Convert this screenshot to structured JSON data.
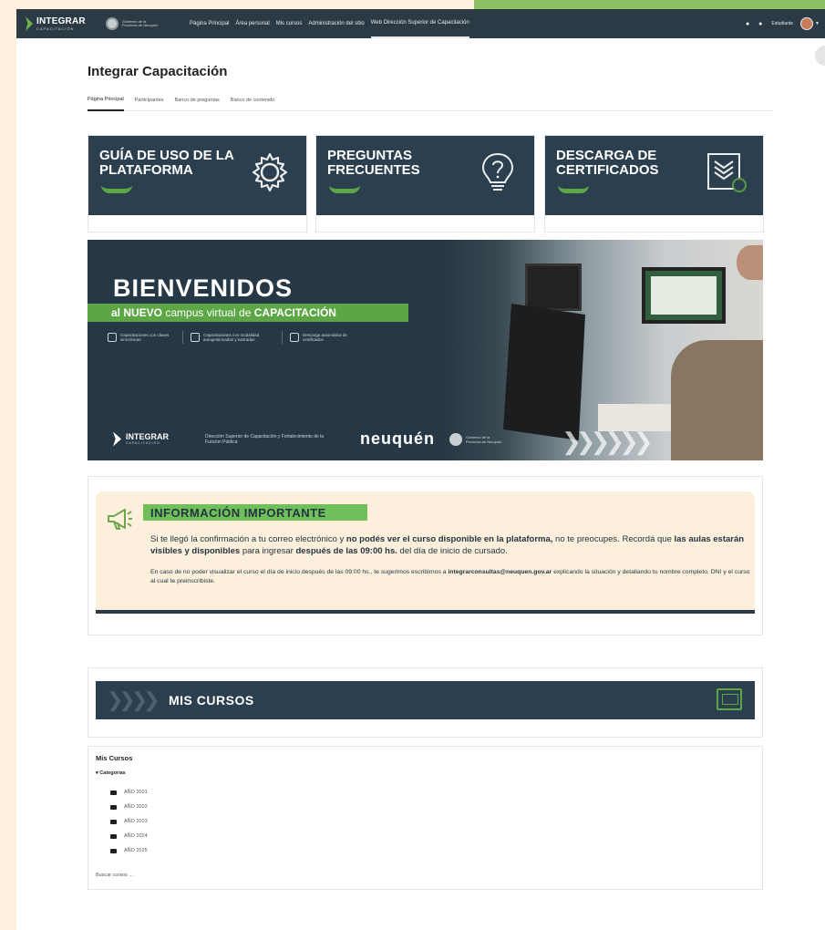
{
  "navbar": {
    "brand": "INTEGRAR",
    "brand_sub": "CAPACITACIÓN",
    "gov_text": "Gobierno de la Provincia de Neuquén",
    "links": [
      "Página Principal",
      "Área personal",
      "Mis cursos",
      "Administración del sitio",
      "Web Dirección Superior de Capacitación"
    ],
    "active_link_index": 4,
    "user": "Estudiante"
  },
  "page": {
    "title": "Integrar Capacitación",
    "tabs": [
      "Página Principal",
      "Participantes",
      "Banco de preguntas",
      "Banco de contenido"
    ]
  },
  "cards": [
    {
      "title": "GUÍA DE USO DE LA PLATAFORMA",
      "icon": "gear-icon"
    },
    {
      "title": "PREGUNTAS FRECUENTES",
      "icon": "lightbulb-question-icon"
    },
    {
      "title": "DESCARGA DE CERTIFICADOS",
      "icon": "certificate-icon"
    }
  ],
  "banner": {
    "title": "BIENVENIDOS",
    "sub_pre": "al ",
    "sub_nuevo": "NUEVO",
    "sub_mid": " campus virtual de ",
    "sub_cap": "CAPACITACIÓN",
    "features": [
      "Capacitaciones con clases sincrónicas",
      "Capacitaciones con modalidad autogestionadas y tutoradas",
      "Descarga automática de certificados"
    ],
    "footer_brand": "INTEGRAR",
    "footer_brand_sub": "CAPACITACIÓN",
    "footer_dir": "Dirección Superior de Capacitación y Fortalecimiento de la Función Pública",
    "footer_province": "neuquén",
    "footer_gov": "Gobierno de la Provincia de Neuquén"
  },
  "info": {
    "title": "INFORMACIÓN IMPORTANTE",
    "p1_a": "Si te llegó la confirmación a tu correo electrónico y ",
    "p1_b": "no podés ver el curso disponible en la plataforma,",
    "p1_c": " no te preocupes. Recordá que ",
    "p1_d": "las aulas estarán visibles y disponibles",
    "p1_e": " para ingresar ",
    "p1_f": "después de las 09:00 hs.",
    "p1_g": " del día de inicio de cursado.",
    "p2_a": "En caso de no poder visualizar el curso el día de inicio después de las 09:00 hs., te sugerimos escribirnos a ",
    "p2_email": "integrarconsultas@neuquen.gov.ar",
    "p2_b": " explicando la situación y detallando tu nombre completo, DNI y el curso al cual te preinscribiste."
  },
  "mis_cursos": {
    "title": "MIS CURSOS"
  },
  "courses": {
    "title": "Mis Cursos",
    "categories_label": "Categorías",
    "categories": [
      "AÑO 2021",
      "AÑO 2022",
      "AÑO 2023",
      "AÑO 2024",
      "AÑO 2025"
    ],
    "search_label": "Buscar cursos ..."
  },
  "colors": {
    "navy": "#2b3f4e",
    "green": "#5ca646",
    "cream": "#fcf0dc"
  }
}
